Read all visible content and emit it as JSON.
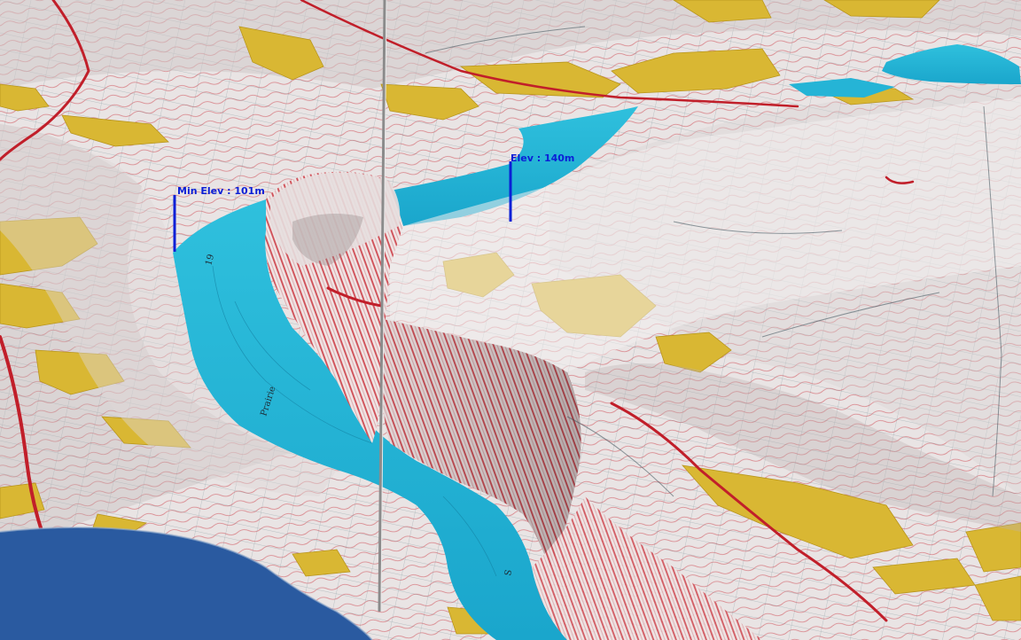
{
  "markers": [
    {
      "label": "Min Elev : 101m",
      "color": "#0b1fd6"
    },
    {
      "label": "Elev : 140m",
      "color": "#0b1fd6"
    }
  ],
  "map_labels": {
    "river_name": "Prairie",
    "shore_label_a": "19",
    "shore_label_b": "S"
  },
  "colors": {
    "water": "#25b4d6",
    "water_shadow": "#138fb3",
    "terrain": "#ece8e8",
    "terrain_shade": "#c9c2c2",
    "contour": "#c9303a",
    "grid": "#5b7a86",
    "parks": "#d9b733",
    "road": "#c11f2a",
    "sea": "#2a5aa0",
    "pole": "#8b8b8b"
  }
}
